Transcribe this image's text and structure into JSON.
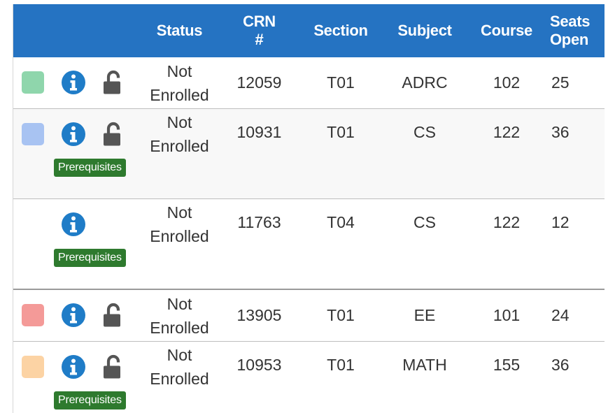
{
  "columns": {
    "status": "Status",
    "crn_line1": "CRN",
    "crn_line2": "#",
    "section": "Section",
    "subject": "Subject",
    "course": "Course",
    "seats_line1": "Seats",
    "seats_line2": "Open"
  },
  "rows": [
    {
      "swatch_color": "#8fd6ac",
      "has_lock": true,
      "prereq": "",
      "status_line1": "Not",
      "status_line2": "Enrolled",
      "crn": "12059",
      "section": "T01",
      "subject": "ADRC",
      "course": "102",
      "seats": "25"
    },
    {
      "swatch_color": "#a8c3f2",
      "has_lock": true,
      "prereq": "Prerequisites",
      "status_line1": "Not",
      "status_line2": "Enrolled",
      "crn": "10931",
      "section": "T01",
      "subject": "CS",
      "course": "122",
      "seats": "36"
    },
    {
      "swatch_color": "",
      "has_lock": false,
      "prereq": "Prerequisites",
      "status_line1": "Not",
      "status_line2": "Enrolled",
      "crn": "11763",
      "section": "T04",
      "subject": "CS",
      "course": "122",
      "seats": "12"
    },
    {
      "swatch_color": "#f49a98",
      "has_lock": true,
      "prereq": "",
      "status_line1": "Not",
      "status_line2": "Enrolled",
      "crn": "13905",
      "section": "T01",
      "subject": "EE",
      "course": "101",
      "seats": "24"
    },
    {
      "swatch_color": "#fcd3a4",
      "has_lock": true,
      "prereq": "Prerequisites",
      "status_line1": "Not",
      "status_line2": "Enrolled",
      "crn": "10953",
      "section": "T01",
      "subject": "MATH",
      "course": "155",
      "seats": "36"
    }
  ],
  "colors": {
    "header_bg": "#2573c2",
    "info_icon": "#1f7cc7",
    "lock_icon": "#555555",
    "prereq_badge": "#2e7a2e"
  },
  "icons": {
    "info": "info-circle-icon",
    "lock": "unlocked-padlock-icon"
  }
}
